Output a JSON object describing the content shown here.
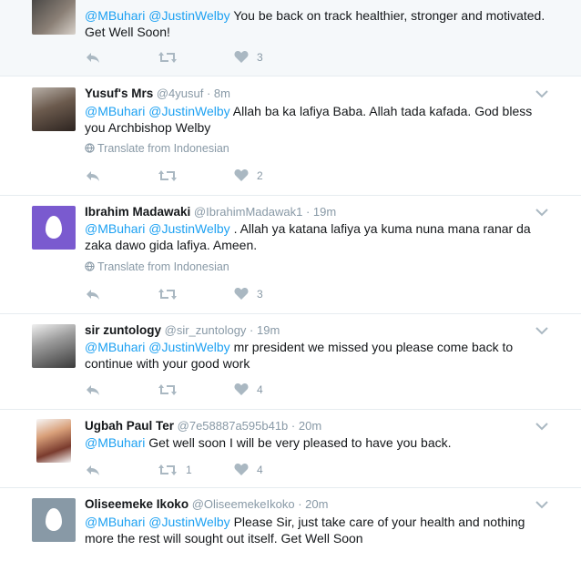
{
  "tweets": [
    {
      "name": "",
      "handle": "",
      "time": "",
      "mentions": [
        "@MBuhari",
        "@JustinWelby"
      ],
      "text": "You be back on track healthier, stronger and motivated. Get Well Soon!",
      "translate": "",
      "retweets": "",
      "likes": "3"
    },
    {
      "name": "Yusuf's Mrs",
      "handle": "@4yusuf",
      "time": "8m",
      "mentions": [
        "@MBuhari",
        "@JustinWelby"
      ],
      "text": "Allah ba ka lafiya Baba. Allah tada kafada. God bless you Archbishop Welby",
      "translate": "Translate from Indonesian",
      "retweets": "",
      "likes": "2"
    },
    {
      "name": "Ibrahim Madawaki",
      "handle": "@IbrahimMadawak1",
      "time": "19m",
      "mentions": [
        "@MBuhari",
        "@JustinWelby"
      ],
      "text": ". Allah ya katana lafiya ya kuma nuna mana ranar da zaka dawo gida lafiya. Ameen.",
      "translate": "Translate from Indonesian",
      "retweets": "",
      "likes": "3"
    },
    {
      "name": "sir zuntology",
      "handle": "@sir_zuntology",
      "time": "19m",
      "mentions": [
        "@MBuhari",
        "@JustinWelby"
      ],
      "text": "mr president we missed you please come back to continue with your good work",
      "translate": "",
      "retweets": "",
      "likes": "4"
    },
    {
      "name": "Ugbah Paul Ter",
      "handle": "@7e58887a595b41b",
      "time": "20m",
      "mentions": [
        "@MBuhari"
      ],
      "text": "Get well soon I will be very pleased to have you back.",
      "translate": "",
      "retweets": "1",
      "likes": "4"
    },
    {
      "name": "Oliseemeke Ikoko",
      "handle": "@OliseemekeIkoko",
      "time": "20m",
      "mentions": [
        "@MBuhari",
        "@JustinWelby"
      ],
      "text": "Please Sir, just take care of your health and nothing more the rest will sought out itself. Get Well Soon",
      "translate": "",
      "retweets": "",
      "likes": ""
    }
  ],
  "separator": " · ",
  "icons": {
    "reply": "reply-icon",
    "retweet": "retweet-icon",
    "like": "heart-icon",
    "caret": "chevron-down-icon",
    "globe": "globe-icon"
  },
  "colors": {
    "link": "#1da1f2",
    "muted": "#8899a6",
    "icon": "#aab8c2",
    "highlight_bg": "#f5f8fa"
  }
}
